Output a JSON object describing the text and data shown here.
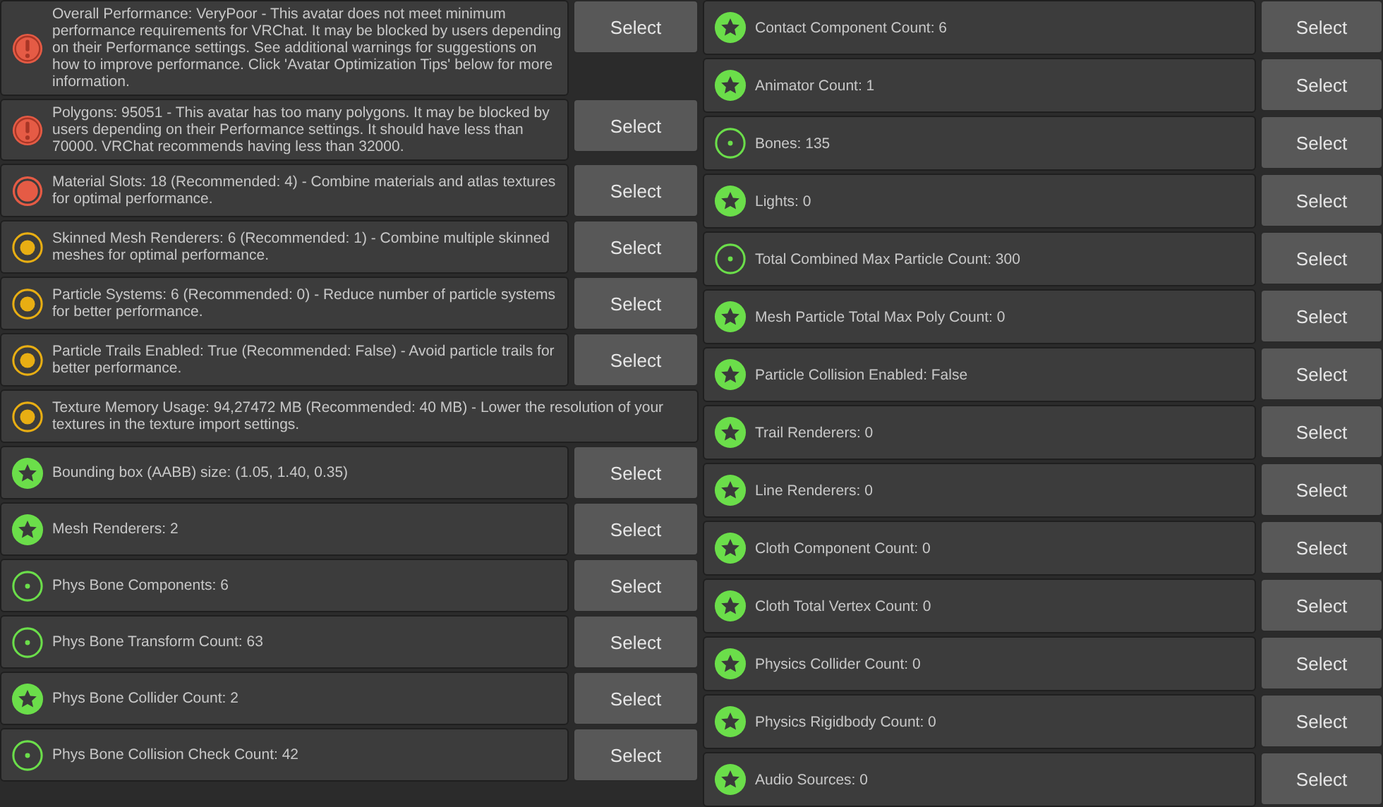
{
  "left_column": [
    {
      "kind": "very_poor",
      "message": "Overall Performance: VeryPoor - This avatar does not meet minimum performance requirements for VRChat. It may be blocked by users depending on their Performance settings. See additional warnings for suggestions on how to improve performance. Click 'Avatar Optimization Tips' below for more information.",
      "button": "Select"
    },
    {
      "kind": "very_poor",
      "message": "Polygons: 95051 - This avatar has too many polygons. It may be blocked by users depending on their Performance settings. It should have less than 70000. VRChat recommends having less than 32000.",
      "button": "Select"
    },
    {
      "kind": "poor",
      "message": "Material Slots: 18 (Recommended: 4) - Combine materials and atlas textures for optimal performance.",
      "button": "Select"
    },
    {
      "kind": "medium",
      "message": "Skinned Mesh Renderers: 6 (Recommended: 1) - Combine multiple skinned meshes for optimal performance.",
      "button": "Select"
    },
    {
      "kind": "medium",
      "message": "Particle Systems: 6 (Recommended: 0) - Reduce number of particle systems for better performance.",
      "button": "Select"
    },
    {
      "kind": "medium",
      "message": "Particle Trails Enabled: True (Recommended: False) - Avoid particle trails for better performance.",
      "button": "Select"
    },
    {
      "kind": "medium",
      "message": "Texture Memory Usage: 94,27472 MB (Recommended: 40 MB) - Lower the resolution of your textures in the texture import settings."
    },
    {
      "kind": "excellent",
      "message": "Bounding box (AABB) size: (1.05, 1.40, 0.35)",
      "button": "Select"
    },
    {
      "kind": "excellent",
      "message": "Mesh Renderers: 2",
      "button": "Select"
    },
    {
      "kind": "good",
      "message": "Phys Bone Components: 6",
      "button": "Select"
    },
    {
      "kind": "good",
      "message": "Phys Bone Transform Count: 63",
      "button": "Select"
    },
    {
      "kind": "excellent",
      "message": "Phys Bone Collider Count: 2",
      "button": "Select"
    },
    {
      "kind": "good",
      "message": "Phys Bone Collision Check Count: 42",
      "button": "Select"
    }
  ],
  "right_column": [
    {
      "kind": "excellent",
      "message": "Contact Component Count: 6",
      "button": "Select"
    },
    {
      "kind": "excellent",
      "message": "Animator Count: 1",
      "button": "Select"
    },
    {
      "kind": "good",
      "message": "Bones: 135",
      "button": "Select"
    },
    {
      "kind": "excellent",
      "message": "Lights: 0",
      "button": "Select"
    },
    {
      "kind": "good",
      "message": "Total Combined Max Particle Count: 300",
      "button": "Select"
    },
    {
      "kind": "excellent",
      "message": "Mesh Particle Total Max Poly Count: 0",
      "button": "Select"
    },
    {
      "kind": "excellent",
      "message": "Particle Collision Enabled: False",
      "button": "Select"
    },
    {
      "kind": "excellent",
      "message": "Trail Renderers: 0",
      "button": "Select"
    },
    {
      "kind": "excellent",
      "message": "Line Renderers: 0",
      "button": "Select"
    },
    {
      "kind": "excellent",
      "message": "Cloth Component Count: 0",
      "button": "Select"
    },
    {
      "kind": "excellent",
      "message": "Cloth Total Vertex Count: 0",
      "button": "Select"
    },
    {
      "kind": "excellent",
      "message": "Physics Collider Count: 0",
      "button": "Select"
    },
    {
      "kind": "excellent",
      "message": "Physics Rigidbody Count: 0",
      "button": "Select"
    },
    {
      "kind": "excellent",
      "message": "Audio Sources: 0",
      "button": "Select"
    }
  ]
}
